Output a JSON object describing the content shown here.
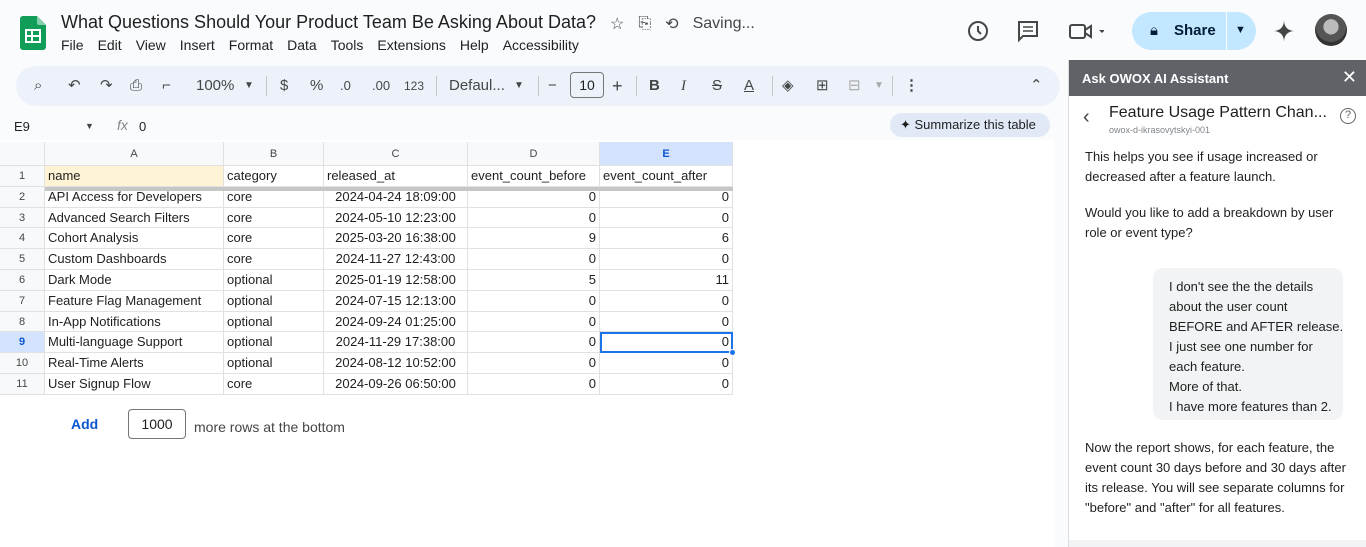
{
  "doc": {
    "title": "What Questions Should Your Product Team Be Asking About Data?",
    "status": "Saving...",
    "menu": [
      "File",
      "Edit",
      "View",
      "Insert",
      "Format",
      "Data",
      "Tools",
      "Extensions",
      "Help",
      "Accessibility"
    ],
    "share_label": "Share"
  },
  "toolbar": {
    "zoom": "100%",
    "currency": "$",
    "percent": "%",
    "dec_decrease": ".0",
    "dec_increase": ".00",
    "number_format": "123",
    "font": "Defaul...",
    "font_size": "10",
    "bold": "B",
    "italic": "I",
    "strike": "S",
    "text_color": "A"
  },
  "formula_bar": {
    "cell_ref": "E9",
    "fx": "fx",
    "value": "0",
    "summarize_label": "Summarize this table"
  },
  "sheet": {
    "columns": [
      "A",
      "B",
      "C",
      "D",
      "E"
    ],
    "headers": [
      "name",
      "category",
      "released_at",
      "event_count_before",
      "event_count_after"
    ],
    "rows": [
      [
        "API Access for Developers",
        "core",
        "2024-04-24 18:09:00",
        "0",
        "0"
      ],
      [
        "Advanced Search Filters",
        "core",
        "2024-05-10 12:23:00",
        "0",
        "0"
      ],
      [
        "Cohort Analysis",
        "core",
        "2025-03-20 16:38:00",
        "9",
        "6"
      ],
      [
        "Custom Dashboards",
        "core",
        "2024-11-27 12:43:00",
        "0",
        "0"
      ],
      [
        "Dark Mode",
        "optional",
        "2025-01-19 12:58:00",
        "5",
        "11"
      ],
      [
        "Feature Flag Management",
        "optional",
        "2024-07-15 12:13:00",
        "0",
        "0"
      ],
      [
        "In-App Notifications",
        "optional",
        "2024-09-24 01:25:00",
        "0",
        "0"
      ],
      [
        "Multi-language Support",
        "optional",
        "2024-11-29 17:38:00",
        "0",
        "0"
      ],
      [
        "Real-Time Alerts",
        "optional",
        "2024-08-12 10:52:00",
        "0",
        "0"
      ],
      [
        "User Signup Flow",
        "core",
        "2024-09-26 06:50:00",
        "0",
        "0"
      ]
    ],
    "row_numbers": [
      "1",
      "2",
      "3",
      "4",
      "5",
      "6",
      "7",
      "8",
      "9",
      "10",
      "11"
    ],
    "add_label": "Add",
    "add_count": "1000",
    "add_suffix": "more rows at the bottom"
  },
  "panel": {
    "header": "Ask OWOX AI Assistant",
    "title": "Feature Usage Pattern Chan...",
    "subtitle": "owox-d-ikrasovytskyi-001",
    "msg1": [
      "This helps you see if usage increased or",
      "decreased after a feature launch."
    ],
    "msg2": [
      "Would you like to add a breakdown by user",
      "role or event type?"
    ],
    "user_msg": [
      "I don't see the the details",
      "about the user count",
      "BEFORE and AFTER release.",
      "I just see one number for",
      "each feature.",
      "More of that.",
      "I have more features than 2."
    ],
    "msg3": [
      "Now the report shows, for each feature, the",
      "event count 30 days before and 30 days after",
      "its release. You will see separate columns for",
      "\"before\" and \"after\" for all features."
    ]
  },
  "colors": {
    "accent": "#1a73e8",
    "share_bg": "#c2e7ff",
    "sheets_green": "#0f9d58",
    "panel_header": "#5f6368"
  }
}
